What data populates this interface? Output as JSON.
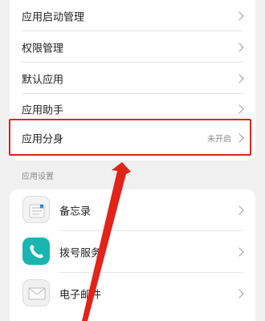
{
  "settings_menu": {
    "items": [
      {
        "label": "应用启动管理"
      },
      {
        "label": "权限管理"
      },
      {
        "label": "默认应用"
      },
      {
        "label": "应用助手"
      },
      {
        "label": "应用分身",
        "status": "未开启"
      }
    ]
  },
  "app_settings": {
    "section_title": "应用设置",
    "apps": [
      {
        "label": "备忘录",
        "icon": "notes-icon"
      },
      {
        "label": "拨号服务",
        "icon": "phone-icon"
      },
      {
        "label": "电子邮件",
        "icon": "mail-icon"
      }
    ]
  },
  "annotation": {
    "highlight_color": "#e2231a",
    "arrow_color": "#e2231a"
  }
}
